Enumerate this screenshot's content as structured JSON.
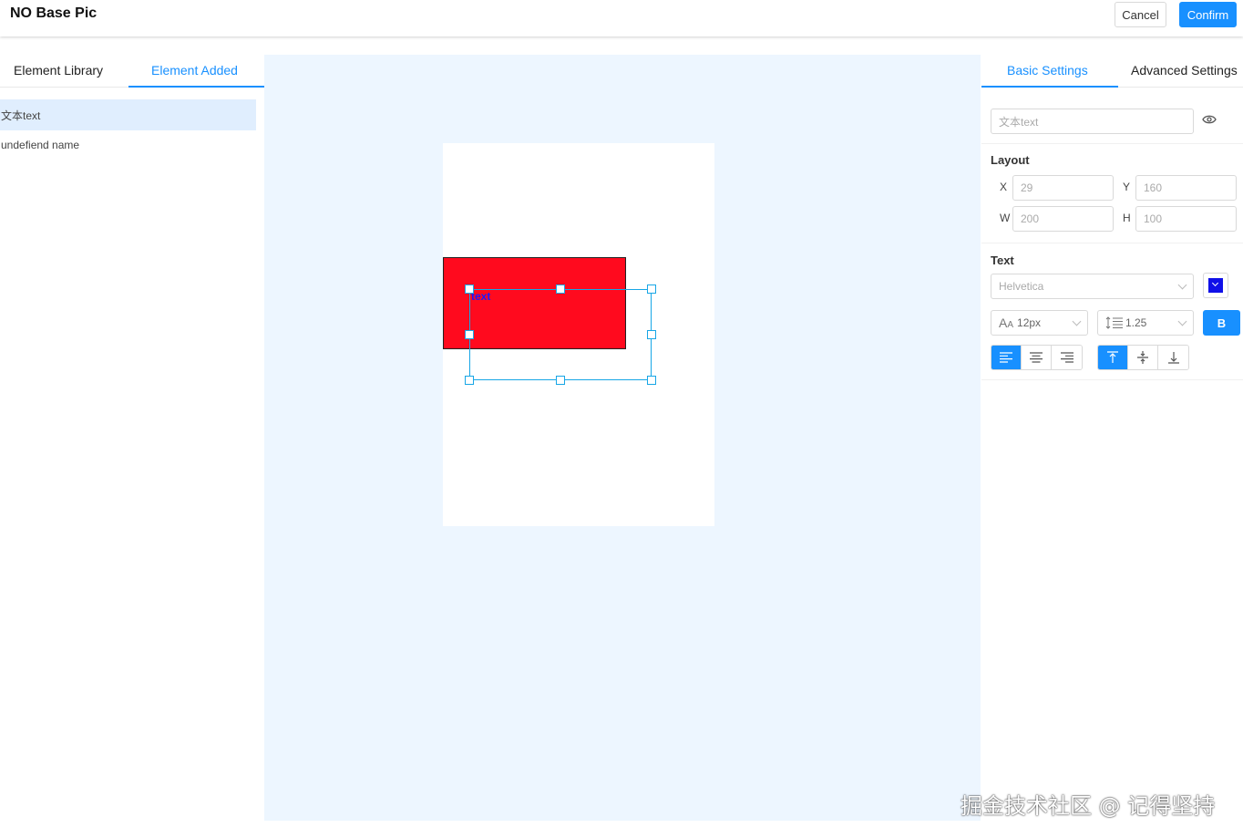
{
  "header": {
    "title": "NO Base Pic",
    "cancel_label": "Cancel",
    "confirm_label": "Confirm"
  },
  "left_panel": {
    "tabs": [
      {
        "label": "Element Library"
      },
      {
        "label": "Element Added"
      }
    ],
    "active_tab": "Element Added",
    "items": [
      {
        "label": "文本text",
        "selected": true
      },
      {
        "label": "undefiend name"
      }
    ]
  },
  "canvas": {
    "selected_text": "text"
  },
  "right_panel": {
    "tabs": [
      {
        "label": "Basic Settings"
      },
      {
        "label": "Advanced Settings"
      }
    ],
    "active_tab": "Basic Settings",
    "name_placeholder": "文本text",
    "layout": {
      "title": "Layout",
      "x_label": "X",
      "x_value": "29",
      "y_label": "Y",
      "y_value": "160",
      "w_label": "W",
      "w_value": "200",
      "h_label": "H",
      "h_value": "100"
    },
    "text": {
      "title": "Text",
      "font": "Helvetica",
      "font_size": "12px",
      "line_height": "1.25",
      "bold_label": "B",
      "color": "#1010e8",
      "align": "left",
      "vertical_align": "top"
    }
  },
  "watermark": "掘金技术社区 @ 记得坚持",
  "colors": {
    "accent": "#1890ff",
    "canvas_bg": "#edf6ff",
    "shape_fill": "#ff0a1e",
    "selection": "#17a6e6"
  }
}
